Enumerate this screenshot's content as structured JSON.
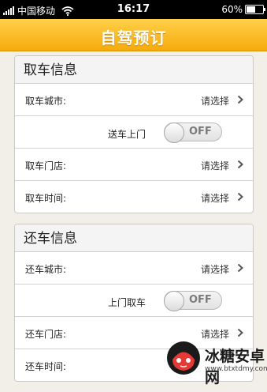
{
  "status_bar": {
    "carrier": "中国移动",
    "time": "16:17",
    "battery_text": "60%",
    "battery_level": 0.6
  },
  "nav": {
    "title": "自驾预订"
  },
  "pickup": {
    "header": "取车信息",
    "rows": [
      {
        "label": "取车城市:",
        "value": "请选择"
      },
      {
        "label": "取车门店:",
        "value": "请选择"
      },
      {
        "label": "取车时间:",
        "value": "请选择"
      }
    ],
    "toggle": {
      "label": "送车上门",
      "state": "OFF"
    }
  },
  "return": {
    "header": "还车信息",
    "rows": [
      {
        "label": "还车城市:",
        "value": "请选择"
      },
      {
        "label": "还车门店:",
        "value": "请选择"
      },
      {
        "label": "还车时间:"
      }
    ],
    "toggle": {
      "label": "上门取车",
      "state": "OFF"
    }
  },
  "watermark": {
    "name": "冰糖安卓网",
    "url": "www.btxtdmy.com"
  },
  "colors": {
    "nav_top": "#ffd04a",
    "nav_bottom": "#f6ab0b",
    "background": "#f2efe8"
  },
  "icons": [
    "signal-icon",
    "wifi-icon",
    "battery-icon",
    "chevron-right-icon"
  ]
}
